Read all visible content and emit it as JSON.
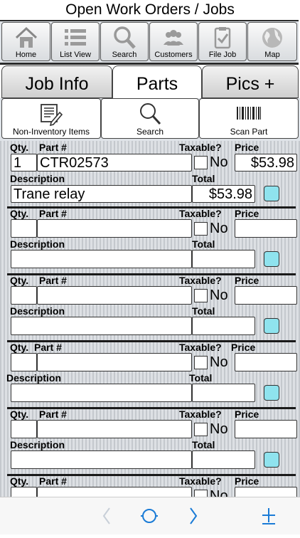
{
  "app": {
    "title": "Open Work Orders / Jobs"
  },
  "nav": [
    {
      "label": "Home",
      "icon": "home-icon"
    },
    {
      "label": "List View",
      "icon": "list-icon"
    },
    {
      "label": "Search",
      "icon": "search-icon"
    },
    {
      "label": "Customers",
      "icon": "customers-icon"
    },
    {
      "label": "File Job",
      "icon": "clipboard-check-icon"
    },
    {
      "label": "Map",
      "icon": "globe-icon"
    }
  ],
  "tabs": [
    {
      "label": "Job Info",
      "active": false
    },
    {
      "label": "Parts",
      "active": true
    },
    {
      "label": "Pics +",
      "active": false
    }
  ],
  "tools": [
    {
      "label": "Non-Inventory Items",
      "icon": "note-pencil-icon"
    },
    {
      "label": "Search",
      "icon": "search-icon"
    },
    {
      "label": "Scan Part",
      "icon": "barcode-icon"
    }
  ],
  "labels": {
    "qty": "Qty.",
    "part": "Part #",
    "taxable": "Taxable?",
    "price": "Price",
    "description": "Description",
    "total": "Total",
    "no": "No"
  },
  "parts": [
    {
      "qty": "1",
      "part": "CTR02573",
      "price": "$53.98",
      "description": "Trane relay",
      "total": "$53.98"
    },
    {
      "qty": "",
      "part": "",
      "price": "",
      "description": "",
      "total": ""
    },
    {
      "qty": "",
      "part": "",
      "price": "",
      "description": "",
      "total": ""
    },
    {
      "qty": "",
      "part": "",
      "price": "",
      "description": "",
      "total": ""
    },
    {
      "qty": "",
      "part": "",
      "price": "",
      "description": "",
      "total": ""
    },
    {
      "qty": "",
      "part": "",
      "price": "",
      "description": "",
      "total": ""
    }
  ],
  "colors": {
    "accent_teal": "#8fe3ee",
    "toolbar_blue": "#1a7bd6"
  }
}
